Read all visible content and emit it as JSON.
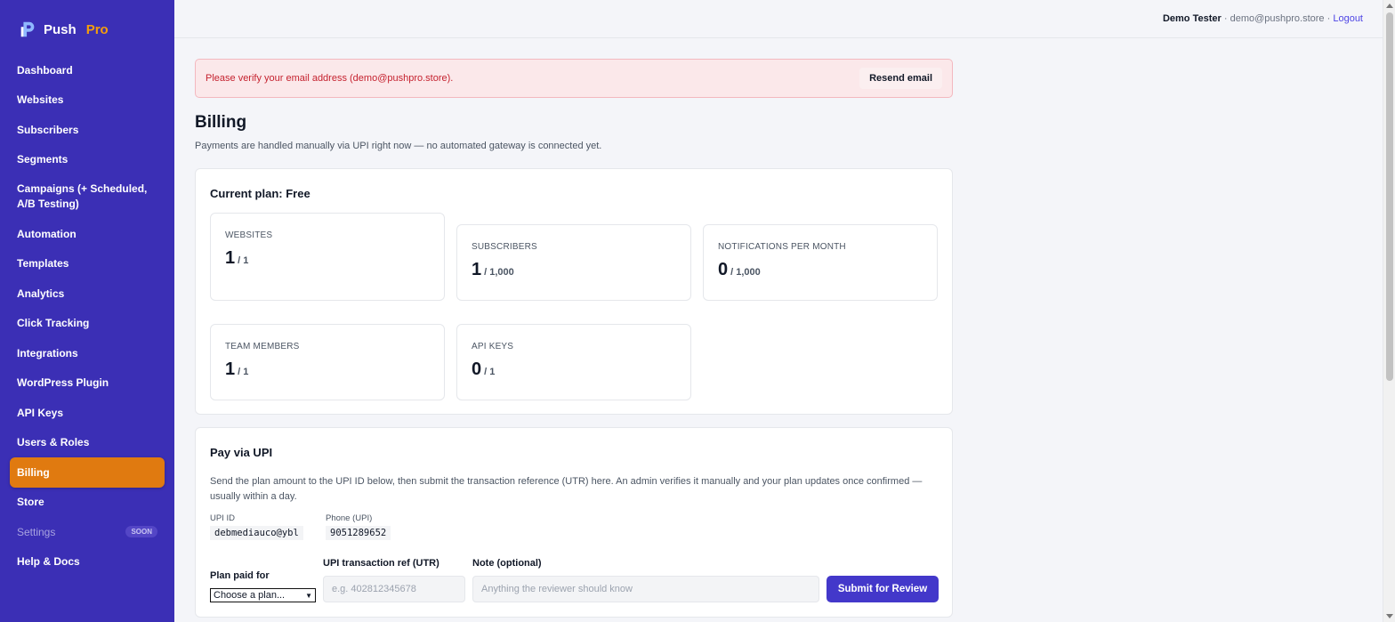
{
  "brand": {
    "name": "Push",
    "suffix": "Pro",
    "logo_icon": "push-logo-icon",
    "accent": "#f59e0b"
  },
  "sidebar": {
    "items": [
      {
        "label": "Dashboard"
      },
      {
        "label": "Websites"
      },
      {
        "label": "Subscribers"
      },
      {
        "label": "Segments"
      },
      {
        "label": "Campaigns (+ Scheduled, A/B Testing)"
      },
      {
        "label": "Automation"
      },
      {
        "label": "Templates"
      },
      {
        "label": "Analytics"
      },
      {
        "label": "Click Tracking"
      },
      {
        "label": "Integrations"
      },
      {
        "label": "WordPress Plugin"
      },
      {
        "label": "API Keys"
      },
      {
        "label": "Users & Roles"
      },
      {
        "label": "Billing",
        "active": true
      },
      {
        "label": "Store"
      },
      {
        "label": "Settings",
        "badge": "SOON",
        "disabled": true
      },
      {
        "label": "Help & Docs"
      }
    ],
    "colors": {
      "background": "#3b2fb5",
      "active": "#e07a10"
    }
  },
  "topbar": {
    "user_name": "Demo Tester",
    "separator": "·",
    "email": "demo@pushpro.store",
    "logout_label": "Logout"
  },
  "alert": {
    "message": "Please verify your email address (demo@pushpro.store).",
    "action_label": "Resend email"
  },
  "page": {
    "title": "Billing",
    "subtitle": "Payments are handled manually via UPI right now — no automated gateway is connected yet."
  },
  "plan": {
    "title": "Current plan: Free",
    "stats": [
      {
        "label": "WEBSITES",
        "value": "1",
        "limit": "/ 1"
      },
      {
        "label": "SUBSCRIBERS",
        "value": "1",
        "limit": "/ 1,000"
      },
      {
        "label": "NOTIFICATIONS PER MONTH",
        "value": "0",
        "limit": "/ 1,000"
      },
      {
        "label": "TEAM MEMBERS",
        "value": "1",
        "limit": "/ 1"
      },
      {
        "label": "API KEYS",
        "value": "0",
        "limit": "/ 1"
      }
    ]
  },
  "upi": {
    "title": "Pay via UPI",
    "description": "Send the plan amount to the UPI ID below, then submit the transaction reference (UTR) here. An admin verifies it manually and your plan updates once confirmed — usually within a day.",
    "upi_id_label": "UPI ID",
    "upi_id": "debmediauco@ybl",
    "phone_label": "Phone (UPI)",
    "phone": "9051289652",
    "form": {
      "plan_label": "Plan paid for",
      "plan_selected": "Choose a plan...",
      "utr_label": "UPI transaction ref (UTR)",
      "utr_placeholder": "e.g. 402812345678",
      "note_label": "Note (optional)",
      "note_placeholder": "Anything the reviewer should know",
      "submit_label": "Submit for Review"
    }
  }
}
